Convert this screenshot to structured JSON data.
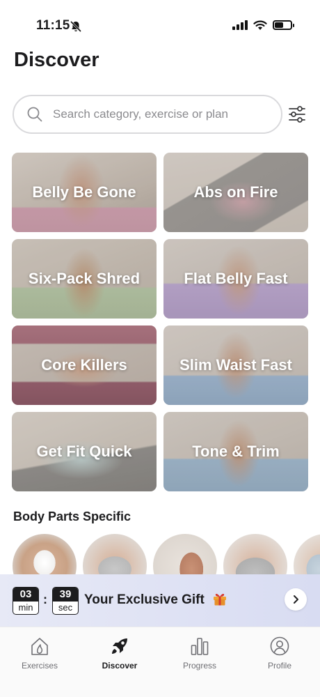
{
  "status_bar": {
    "time": "11:15"
  },
  "header": {
    "title": "Discover"
  },
  "search": {
    "placeholder": "Search category, exercise or plan"
  },
  "plans": [
    {
      "label": "Belly Be Gone"
    },
    {
      "label": "Abs on Fire"
    },
    {
      "label": "Six-Pack Shred"
    },
    {
      "label": "Flat Belly Fast"
    },
    {
      "label": "Core Killers"
    },
    {
      "label": "Slim Waist Fast"
    },
    {
      "label": "Get Fit Quick"
    },
    {
      "label": "Tone & Trim"
    }
  ],
  "body_parts": {
    "title": "Body Parts Specific"
  },
  "gift_banner": {
    "minutes": "03",
    "minutes_unit": "min",
    "separator": ":",
    "seconds": "39",
    "seconds_unit": "sec",
    "text": "Your Exclusive Gift"
  },
  "tabs": [
    {
      "label": "Exercises",
      "icon": "exercises-icon",
      "active": false
    },
    {
      "label": "Discover",
      "icon": "rocket-icon",
      "active": true
    },
    {
      "label": "Progress",
      "icon": "bar-chart-icon",
      "active": false
    },
    {
      "label": "Profile",
      "icon": "profile-icon",
      "active": false
    }
  ],
  "colors": {
    "banner_start": "#e7e9f6",
    "banner_end": "#d8dcf2",
    "text_primary": "#1c1c1e",
    "text_secondary": "#6e6e73"
  }
}
